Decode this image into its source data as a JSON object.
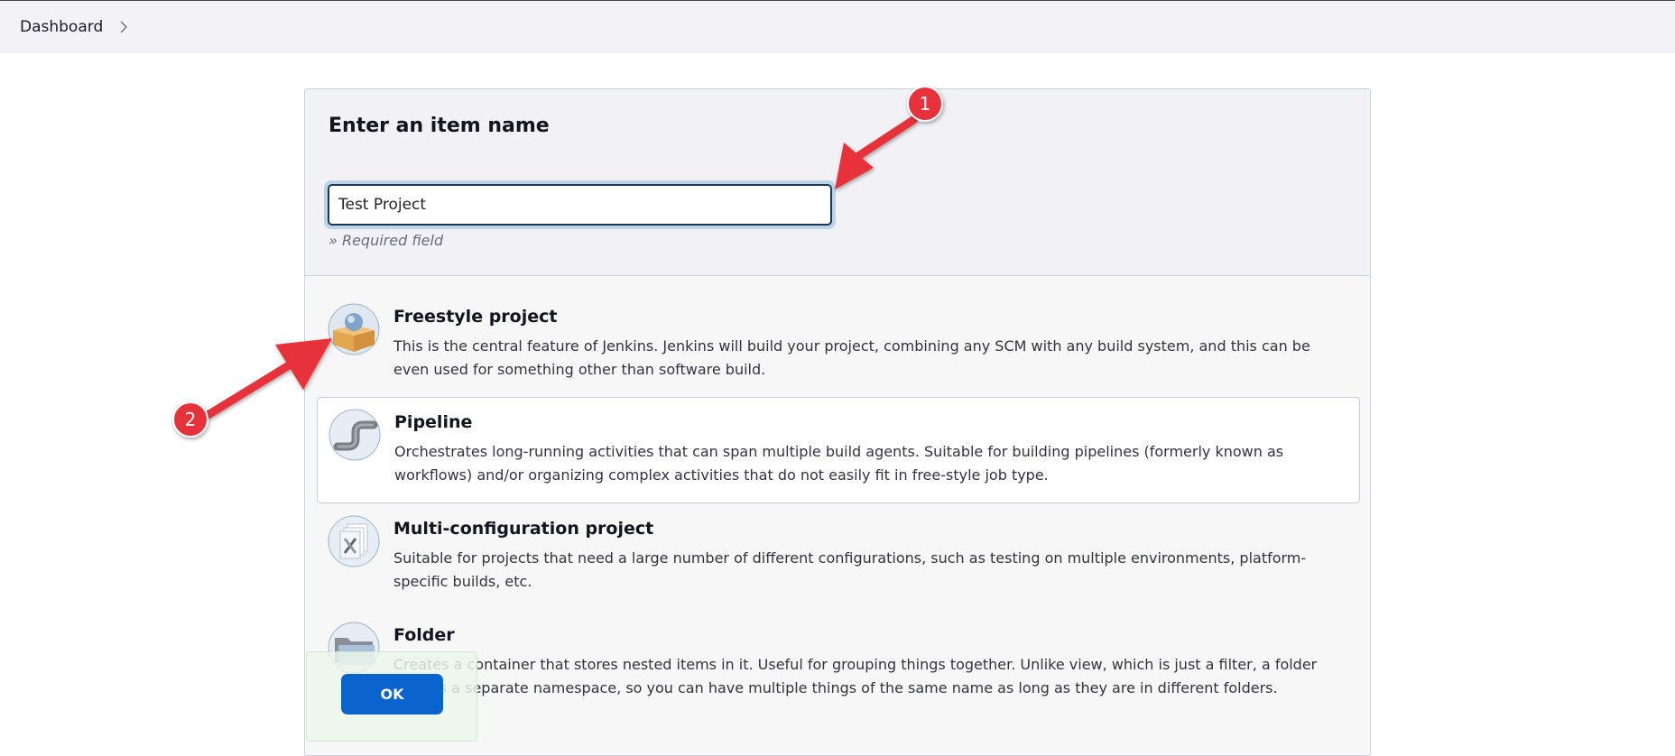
{
  "breadcrumb": {
    "items": [
      "Dashboard"
    ]
  },
  "form": {
    "title": "Enter an item name",
    "name_value": "Test Project",
    "required_note": "» Required field"
  },
  "items": [
    {
      "title": "Freestyle project",
      "description": "This is the central feature of Jenkins. Jenkins will build your project, combining any SCM with any build system, and this can be even used for something other than software build.",
      "icon": "freestyle-box-icon"
    },
    {
      "title": "Pipeline",
      "description": "Orchestrates long-running activities that can span multiple build agents. Suitable for building pipelines (formerly known as workflows) and/or organizing complex activities that do not easily fit in free-style job type.",
      "icon": "pipeline-pipe-icon"
    },
    {
      "title": "Multi-configuration project",
      "description": "Suitable for projects that need a large number of different configurations, such as testing on multiple environments, platform-specific builds, etc.",
      "icon": "multi-config-icon"
    },
    {
      "title": "Folder",
      "description": "Creates a container that stores nested items in it. Useful for grouping things together. Unlike view, which is just a filter, a folder creates a separate namespace, so you can have multiple things of the same name as long as they are in different folders.",
      "icon": "folder-icon"
    }
  ],
  "ok_button": {
    "label": "OK"
  },
  "annotations": {
    "marker_1": "1",
    "marker_2": "2"
  },
  "colors": {
    "accent": "#0b63ce",
    "annotation_red": "#e8333a",
    "input_border": "#1d3557"
  }
}
